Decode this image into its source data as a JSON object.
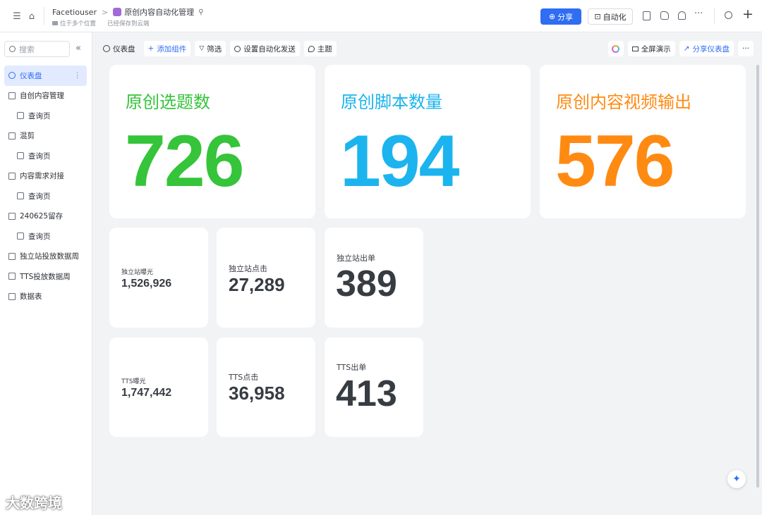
{
  "topbar": {
    "breadcrumb_root": "Facetiouser",
    "breadcrumb_sep": ">",
    "doc_title": "原创内容自动化管理",
    "location_text": "位于多个位置",
    "saved_text": "已经保存到云端",
    "share_label": "分享",
    "automation_label": "自动化"
  },
  "sidebar": {
    "search_placeholder": "搜索",
    "items": [
      {
        "label": "仪表盘",
        "type": "dashboard",
        "active": true
      },
      {
        "label": "自创内容管理",
        "type": "table"
      },
      {
        "label": "查询页",
        "type": "form",
        "sub": true
      },
      {
        "label": "混剪",
        "type": "table"
      },
      {
        "label": "查询页",
        "type": "form",
        "sub": true
      },
      {
        "label": "内容需求对接",
        "type": "table"
      },
      {
        "label": "查询页",
        "type": "form",
        "sub": true
      },
      {
        "label": "240625留存",
        "type": "table"
      },
      {
        "label": "查询页",
        "type": "form",
        "sub": true
      },
      {
        "label": "独立站投放数据周",
        "type": "table"
      },
      {
        "label": "TTS投放数据周",
        "type": "table"
      },
      {
        "label": "数据表",
        "type": "table"
      }
    ]
  },
  "toolbar": {
    "dashboard": "仪表盘",
    "add_widget": "添加组件",
    "filter": "筛选",
    "auto_send": "设置自动化发送",
    "theme": "主题",
    "fullscreen": "全屏演示",
    "share_dashboard": "分享仪表盘"
  },
  "big_cards": [
    {
      "title": "原创选题数",
      "value": "726",
      "color": "#35c43a"
    },
    {
      "title": "原创脚本数量",
      "value": "194",
      "color": "#1cb4ee"
    },
    {
      "title": "原创内容视频输出",
      "value": "576",
      "color": "#ff8a12"
    }
  ],
  "small_cards": [
    {
      "title": "独立站曝光",
      "value": "1,526,926"
    },
    {
      "title": "独立站点击",
      "value": "27,289"
    },
    {
      "title": "独立站出单",
      "value": "389"
    },
    {
      "title": "TTS曝光",
      "value": "1,747,442"
    },
    {
      "title": "TTS点击",
      "value": "36,958"
    },
    {
      "title": "TTS出单",
      "value": "413"
    }
  ],
  "watermark": "大数跨境",
  "icons": {
    "menu": "☰",
    "home": "⌂",
    "pin": "⚲",
    "globe": "⊕",
    "bot": "⊡",
    "more": "···",
    "search": "⌕",
    "plus": "+",
    "sparkle": "✦"
  }
}
